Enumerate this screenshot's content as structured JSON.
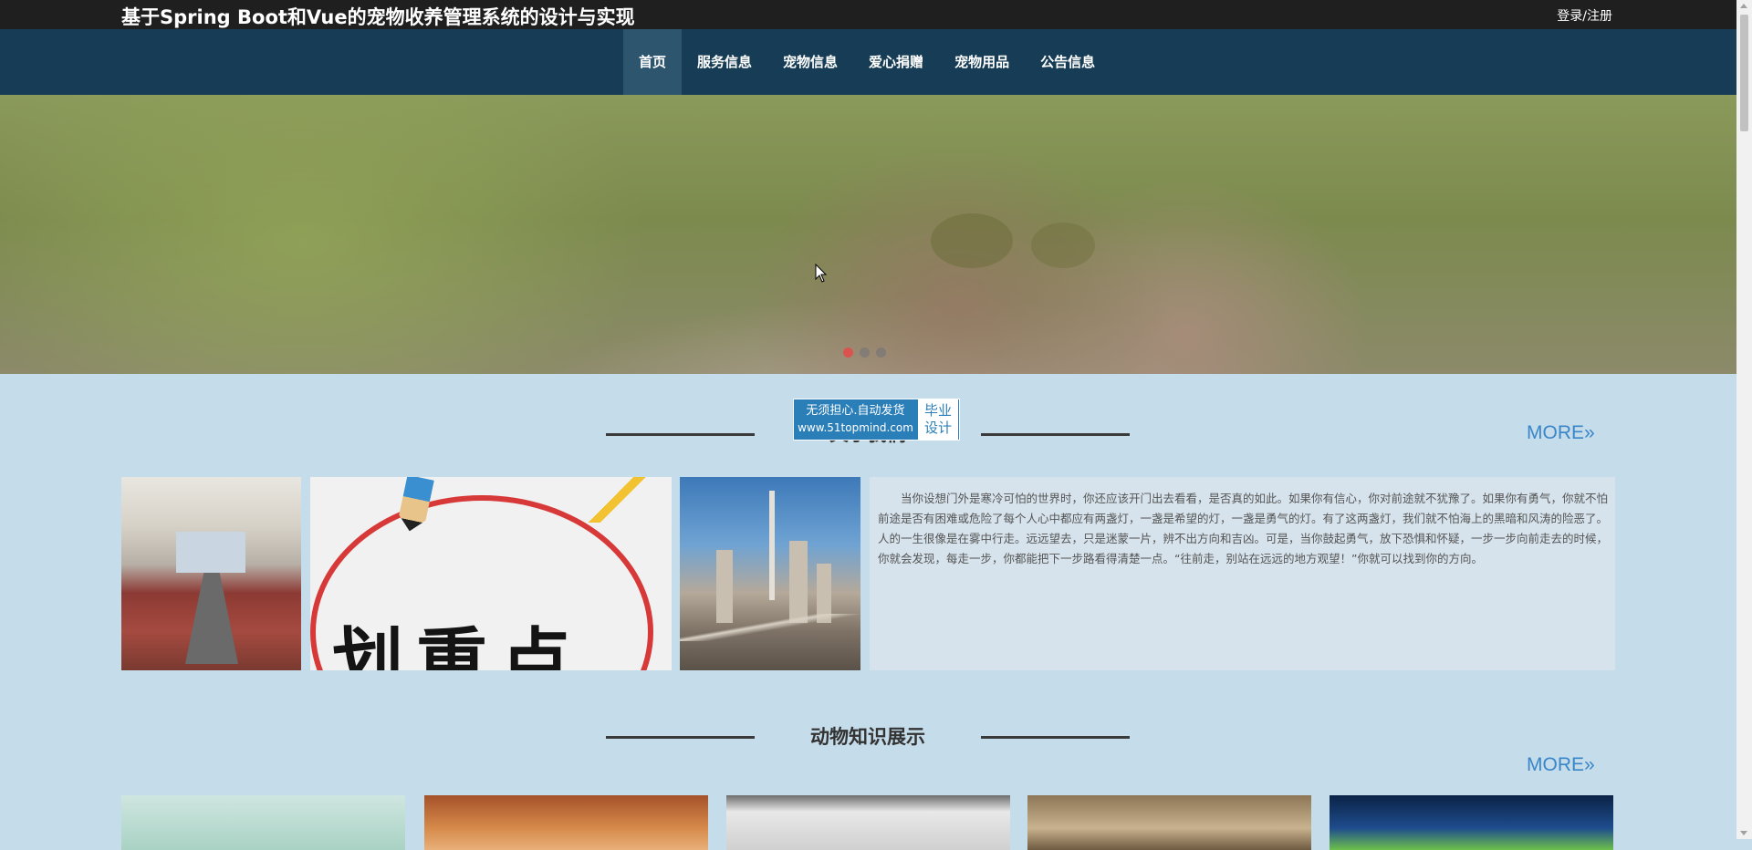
{
  "header": {
    "site_title": "基于Spring Boot和Vue的宠物收养管理系统的设计与实现",
    "login_label": "登录/注册"
  },
  "nav": {
    "items": [
      {
        "label": "首页",
        "active": true
      },
      {
        "label": "服务信息",
        "active": false
      },
      {
        "label": "宠物信息",
        "active": false
      },
      {
        "label": "爱心捐赠",
        "active": false
      },
      {
        "label": "宠物用品",
        "active": false
      },
      {
        "label": "公告信息",
        "active": false
      }
    ]
  },
  "banner": {
    "slide_count": 3,
    "active_slide": 1
  },
  "watermark": {
    "line1": "无须担心.自动发货",
    "url": "www.51topmind.com",
    "badge_line1": "毕业",
    "badge_line2": "设计"
  },
  "about": {
    "title": "关于我们",
    "more_label": "MORE",
    "text": "当你设想门外是寒冷可怕的世界时，你还应该开门出去看看，是否真的如此。如果你有信心，你对前途就不犹豫了。如果你有勇气，你就不怕前途是否有困难或危险了每个人心中都应有两盏灯，一盏是希望的灯，一盏是勇气的灯。有了这两盏灯，我们就不怕海上的黑暗和风涛的险恶了。人的一生很像是在雾中行走。远远望去，只是迷蒙一片，辨不出方向和吉凶。可是，当你鼓起勇气，放下恐惧和怀疑，一步一步向前走去的时候，你就会发现，每走一步，你都能把下一步路看得清楚一点。“往前走，别站在远远的地方观望！”你就可以找到你的方向。",
    "highlight_image_text": "划重点"
  },
  "knowledge": {
    "title": "动物知识展示",
    "more_label": "MORE"
  },
  "colors": {
    "topbar": "#1f1f1f",
    "navbar": "#163d55",
    "nav_active": "#2d556d",
    "page_bg": "#c5dcea",
    "more_link": "#3a86c8",
    "dot_active": "#d9534f"
  }
}
